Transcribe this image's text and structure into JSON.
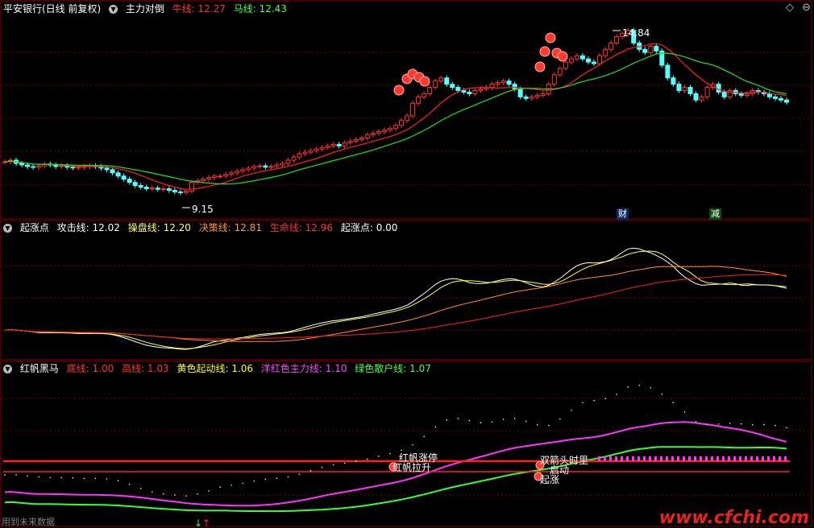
{
  "panel1": {
    "stock": "平安银行(日线 前复权)",
    "indicator": "主力对倒",
    "niu_label": "牛线: 12.27",
    "ma_label": "马线: 12.43",
    "high_label": "14.84",
    "low_label": "9.15",
    "badge_cai": "财",
    "badge_jian": "减"
  },
  "panel2": {
    "indicator": "起涨点",
    "items": [
      {
        "text": "攻击线: 12.02",
        "color": "#ffffff"
      },
      {
        "text": "操盘线: 12.20",
        "color": "#ffff66"
      },
      {
        "text": "决策线: 12.81",
        "color": "#ff9933"
      },
      {
        "text": "生命线: 12.96",
        "color": "#ff3030"
      },
      {
        "text": "起涨点: 0.00",
        "color": "#ffffff"
      }
    ]
  },
  "panel3": {
    "indicator": "红帆黑马",
    "items": [
      {
        "text": "底线: 1.00",
        "color": "#ff3030"
      },
      {
        "text": "高线: 1.03",
        "color": "#ff3030"
      },
      {
        "text": "黄色起动线: 1.06",
        "color": "#ffff00"
      },
      {
        "text": "洋红色主力线: 1.10",
        "color": "#ff44ff"
      },
      {
        "text": "绿色散户线: 1.07",
        "color": "#44ff44"
      }
    ],
    "labels": [
      "红帆涨停",
      "红帆拉升",
      "双箭头时里",
      "启动",
      "起涨"
    ]
  },
  "footer": "用到未来数据",
  "watermark": "www.cfchi.com",
  "colors": {
    "up": "#ff3232",
    "down": "#54ffff",
    "red": "#ff2020",
    "green": "#20e020",
    "yellow": "#ffff40",
    "orange": "#ff8c30",
    "magenta": "#ff33ff",
    "grid": "#7a0000"
  },
  "chart_data": {
    "type": "line",
    "close": [
      10.55,
      10.6,
      10.5,
      10.45,
      10.4,
      10.38,
      10.42,
      10.48,
      10.45,
      10.4,
      10.42,
      10.38,
      10.36,
      10.38,
      10.4,
      10.42,
      10.4,
      10.35,
      10.3,
      10.2,
      10.1,
      10.0,
      9.9,
      9.8,
      9.75,
      9.7,
      9.72,
      9.68,
      9.7,
      9.65,
      9.6,
      9.58,
      9.62,
      9.9,
      9.95,
      10.0,
      10.05,
      10.1,
      10.1,
      10.15,
      10.2,
      10.25,
      10.3,
      10.35,
      10.4,
      10.42,
      10.38,
      10.4,
      10.45,
      10.5,
      10.6,
      10.7,
      10.8,
      10.85,
      10.9,
      10.95,
      11.0,
      11.05,
      11.1,
      11.05,
      11.15,
      11.2,
      11.25,
      11.3,
      11.4,
      11.45,
      11.5,
      11.55,
      11.6,
      11.7,
      11.85,
      12.0,
      12.4,
      12.6,
      12.7,
      12.9,
      13.1,
      13.2,
      13.0,
      12.9,
      12.8,
      12.75,
      12.7,
      12.8,
      12.85,
      12.9,
      13.0,
      13.05,
      13.1,
      13.0,
      12.85,
      12.6,
      12.55,
      12.6,
      12.65,
      12.7,
      13.0,
      13.3,
      13.5,
      13.7,
      13.8,
      13.9,
      13.8,
      13.7,
      13.65,
      13.9,
      14.1,
      14.3,
      14.5,
      14.6,
      14.7,
      14.3,
      14.1,
      14.0,
      14.2,
      14.05,
      13.6,
      13.2,
      13.0,
      12.8,
      12.9,
      12.7,
      12.5,
      12.6,
      12.9,
      13.0,
      12.75,
      12.6,
      12.8,
      12.7,
      12.65,
      12.7,
      12.8,
      12.75,
      12.7,
      12.6,
      12.55,
      12.5,
      12.43
    ]
  }
}
